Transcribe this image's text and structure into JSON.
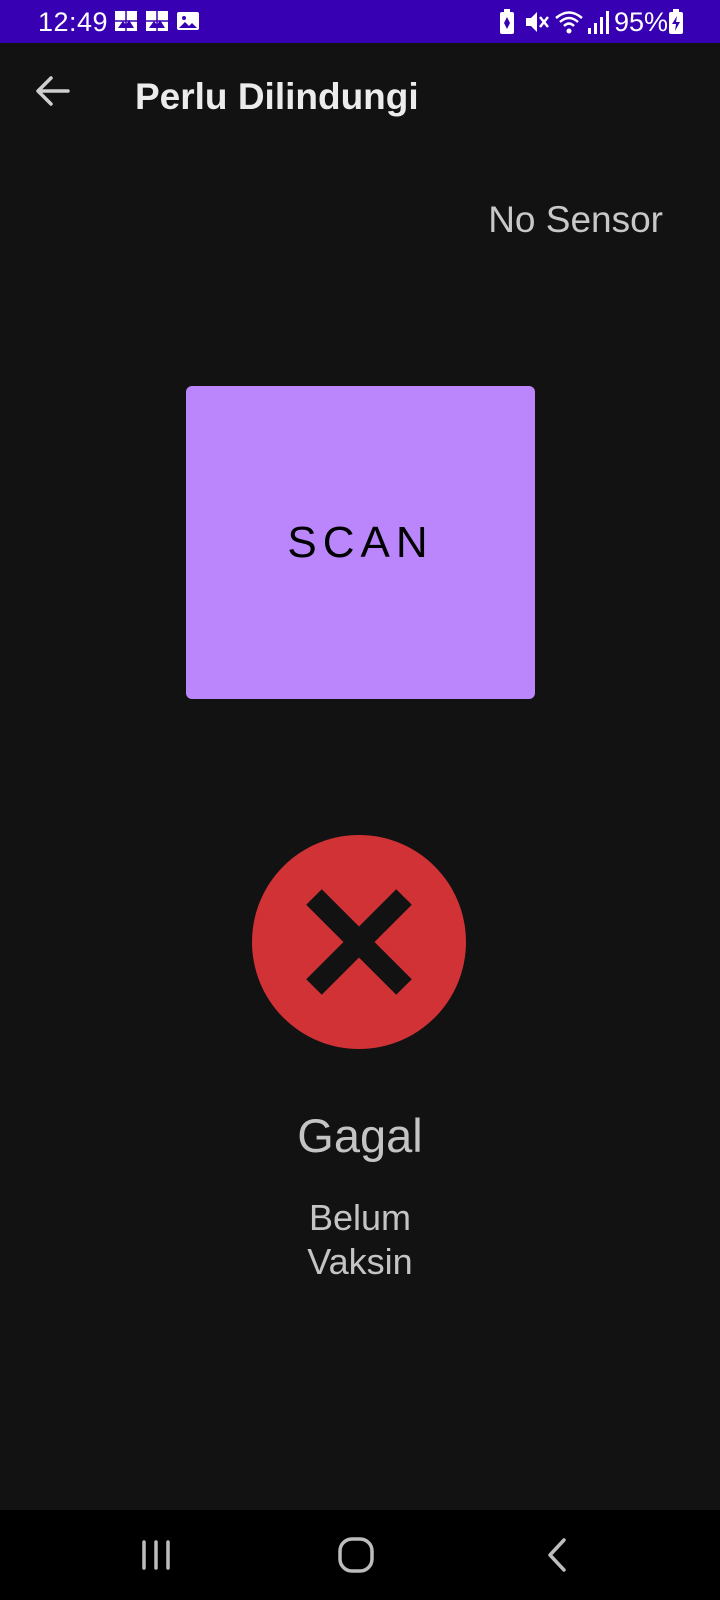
{
  "status_bar": {
    "time": "12:49",
    "battery": "95%",
    "background_color": "#3700b3",
    "notification_icons": [
      "gallery-icon",
      "gallery-icon",
      "image-icon"
    ],
    "system_icons": [
      "battery-saver-icon",
      "mute-icon",
      "wifi-icon",
      "signal-icon",
      "battery-charging-icon"
    ]
  },
  "app_bar": {
    "title": "Perlu Dilindungi",
    "back_icon": "arrow-left-icon"
  },
  "sensor": {
    "status": "No Sensor"
  },
  "scan": {
    "label": "SCAN",
    "color": "#bb86fc"
  },
  "result": {
    "icon": "close-circle-icon",
    "icon_color": "#d03236",
    "title": "Gagal",
    "detail_line1": "Belum",
    "detail_line2": "Vaksin"
  },
  "nav_bar": {
    "items": [
      "recent-apps-icon",
      "home-icon",
      "back-icon"
    ]
  }
}
